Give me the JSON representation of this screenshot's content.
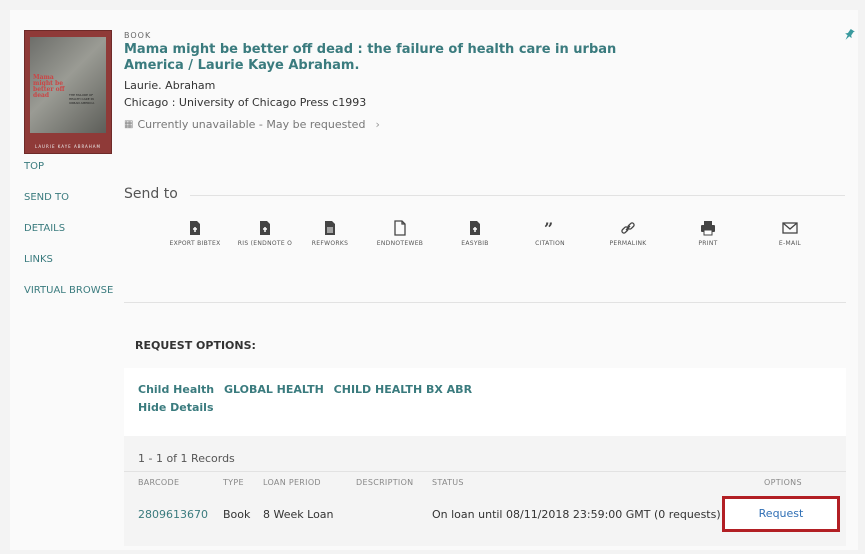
{
  "record": {
    "type": "BOOK",
    "title": "Mama might be better off dead : the failure of health care in urban America / Laurie Kaye Abraham.",
    "author": "Laurie. Abraham",
    "publication": "Chicago : University of Chicago Press c1993",
    "availability": "Currently unavailable - May be requested"
  },
  "cover": {
    "title_text": "Mama might be better off dead",
    "subtitle_text": "THE FAILURE OF HEALTH CARE IN URBAN AMERICA",
    "author_text": "LAURIE KAYE ABRAHAM"
  },
  "nav": [
    "TOP",
    "SEND TO",
    "DETAILS",
    "LINKS",
    "VIRTUAL BROWSE"
  ],
  "send_to": {
    "label": "Send to",
    "actions": [
      {
        "label": "EXPORT BIBTEX",
        "icon": "file-export-icon"
      },
      {
        "label": "RIS (ENDNOTE O",
        "icon": "file-export-icon"
      },
      {
        "label": "REFWORKS",
        "icon": "file-text-icon"
      },
      {
        "label": "ENDNOTEWEB",
        "icon": "file-outline-icon"
      },
      {
        "label": "EASYBIB",
        "icon": "file-export-icon"
      },
      {
        "label": "CITATION",
        "icon": "quote-icon"
      },
      {
        "label": "PERMALINK",
        "icon": "link-icon"
      },
      {
        "label": "PRINT",
        "icon": "printer-icon"
      },
      {
        "label": "E-MAIL",
        "icon": "envelope-icon"
      }
    ]
  },
  "request": {
    "label": "REQUEST OPTIONS:",
    "location": {
      "library": "Child Health",
      "collection": "GLOBAL HEALTH",
      "call_number": "CHILD HEALTH BX ABR"
    },
    "hide_details": "Hide Details",
    "records_count": "1 - 1 of 1 Records",
    "columns": [
      "BARCODE",
      "TYPE",
      "LOAN PERIOD",
      "DESCRIPTION",
      "STATUS",
      "OPTIONS"
    ],
    "rows": [
      {
        "barcode": "2809613670",
        "type": "Book",
        "loan_period": "8 Week Loan",
        "description": "",
        "status": "On loan until 08/11/2018 23:59:00 GMT (0 requests)",
        "option": "Request"
      }
    ]
  },
  "colors": {
    "accent": "#3a7b7e",
    "request_border": "#b21f24",
    "request_link": "#2f6fb5"
  }
}
